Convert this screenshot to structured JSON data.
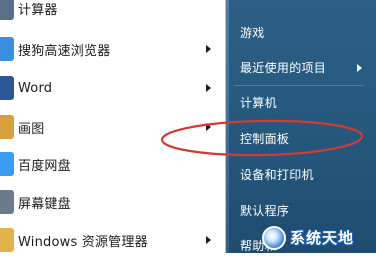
{
  "left_menu": {
    "items": [
      {
        "label": "计算器",
        "icon": "calculator-icon",
        "icon_color": "#5b6f8a",
        "has_submenu": false
      },
      {
        "label": "搜狗高速浏览器",
        "icon": "sogou-browser-icon",
        "icon_color": "#3b8de0",
        "has_submenu": true
      },
      {
        "label": "Word",
        "icon": "word-icon",
        "icon_color": "#2b5797",
        "has_submenu": true
      },
      {
        "label": "画图",
        "icon": "paint-icon",
        "icon_color": "#d8a03c",
        "has_submenu": true
      },
      {
        "label": "百度网盘",
        "icon": "baidu-netdisk-icon",
        "icon_color": "#3a9bf0",
        "has_submenu": false
      },
      {
        "label": "屏幕键盘",
        "icon": "keyboard-icon",
        "icon_color": "#6b7b8c",
        "has_submenu": false
      },
      {
        "label": "Windows 资源管理器",
        "icon": "explorer-folder-icon",
        "icon_color": "#e1b34a",
        "has_submenu": true
      }
    ]
  },
  "right_menu": {
    "items": [
      {
        "label": "游戏",
        "has_submenu": false
      },
      {
        "label": "最近使用的项目",
        "has_submenu": true
      },
      {
        "label": "计算机",
        "has_submenu": false
      },
      {
        "label": "控制面板",
        "has_submenu": false
      },
      {
        "label": "设备和打印机",
        "has_submenu": false
      },
      {
        "label": "默认程序",
        "has_submenu": false
      },
      {
        "label": "帮助和",
        "has_submenu": false
      }
    ]
  },
  "annotation": {
    "color": "#d23a32",
    "target": "控制面板"
  },
  "watermark": {
    "text": "系统天地"
  }
}
